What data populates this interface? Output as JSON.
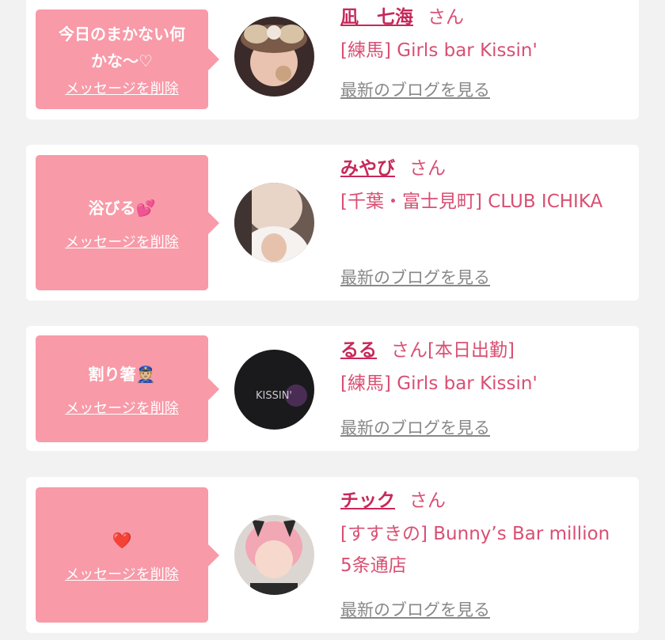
{
  "cards": [
    {
      "message": "今日のまかない何\nかな〜♡",
      "delete_label": "メッセージを削除",
      "name": "凪　七海",
      "honorific": "さん",
      "shop": "[練馬] Girls bar Kissin'",
      "blog_label": "最新のブログを見る"
    },
    {
      "message": "浴びる💕",
      "delete_label": "メッセージを削除",
      "name": "みやび",
      "honorific": "さん",
      "shop": "[千葉・富士見町] CLUB ICHIKA",
      "blog_label": "最新のブログを見る"
    },
    {
      "message": "割り箸👮🏼",
      "delete_label": "メッセージを削除",
      "name": "るる",
      "honorific": "さん[本日出勤]",
      "shop": "[練馬] Girls bar Kissin'",
      "blog_label": "最新のブログを見る",
      "avatar_text": "KISSIN'"
    },
    {
      "message": "❤️",
      "delete_label": "メッセージを削除",
      "name": "チック",
      "honorific": "さん",
      "shop": "[すすきの] Bunny’s Bar million 5条通店",
      "blog_label": "最新のブログを見る"
    }
  ],
  "colors": {
    "bubble": "#f89aa8",
    "name": "#c7285a",
    "shop": "#d94f72",
    "link_gray": "#888888",
    "background": "#f2f2f2"
  }
}
